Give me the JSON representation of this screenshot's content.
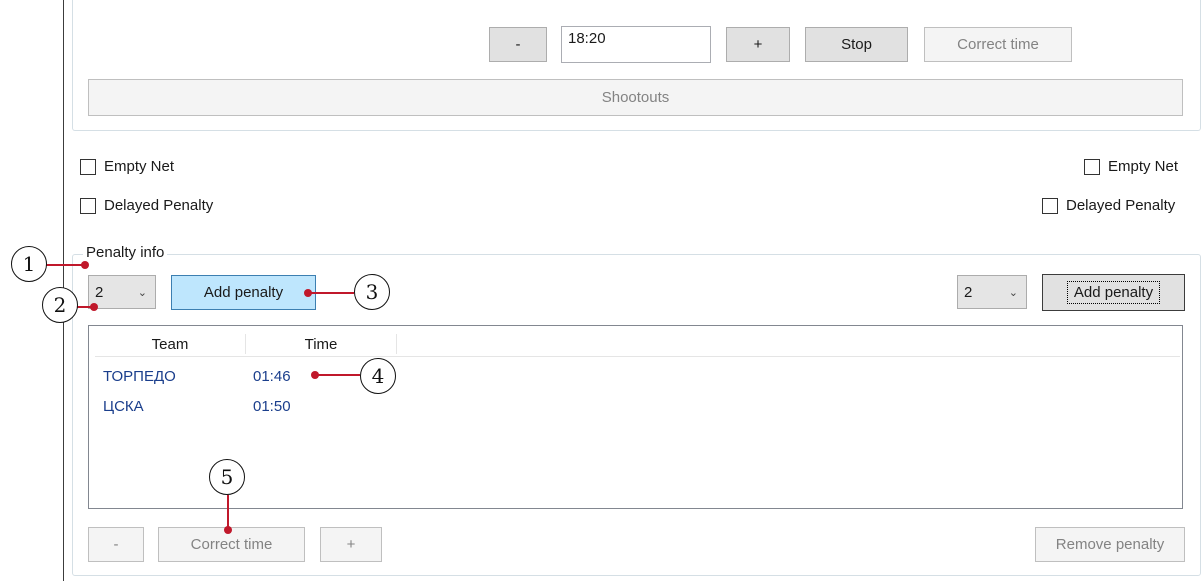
{
  "timer": {
    "minus_label": "-",
    "time_value": "18:20",
    "plus_label": "+",
    "stop_label": "Stop",
    "correct_time_label": "Correct time",
    "shootouts_label": "Shootouts"
  },
  "left_options": {
    "empty_net": "Empty Net",
    "delayed_penalty": "Delayed Penalty"
  },
  "right_options": {
    "empty_net": "Empty Net",
    "delayed_penalty": "Delayed Penalty"
  },
  "penalty_info": {
    "title": "Penalty info",
    "left_minutes": "2",
    "left_add_label": "Add penalty",
    "right_minutes": "2",
    "right_add_label": "Add penalty",
    "columns": [
      "Team",
      "Time"
    ],
    "rows": [
      {
        "team": "ТОРПЕДО",
        "time": "01:46"
      },
      {
        "team": "ЦСКА",
        "time": "01:50"
      }
    ],
    "minus_label": "-",
    "correct_time_label": "Correct time",
    "plus_label": "+",
    "remove_label": "Remove penalty"
  },
  "callouts": [
    "1",
    "2",
    "3",
    "4",
    "5"
  ],
  "colors": {
    "callout": "#c0182b",
    "row_text": "#1a3e8c",
    "hot_button": "#bee6fd"
  }
}
